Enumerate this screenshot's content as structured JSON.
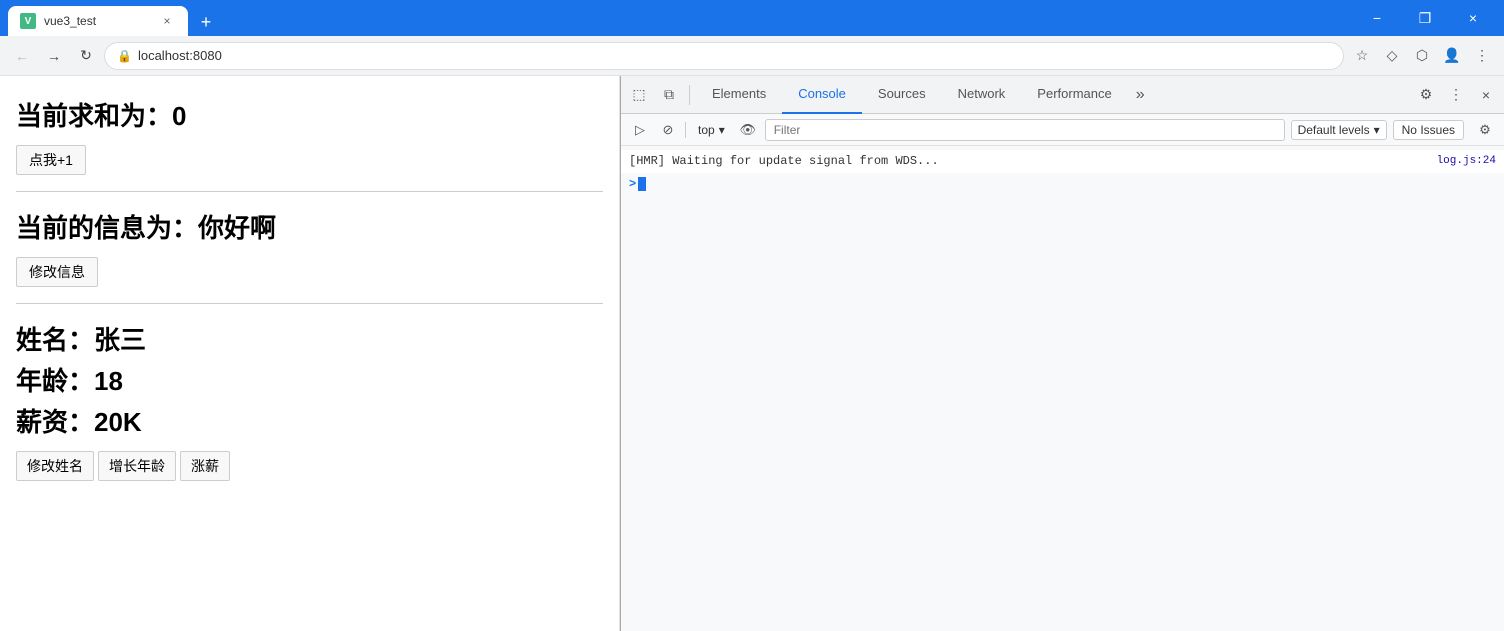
{
  "browser": {
    "tab_favicon": "V",
    "tab_title": "vue3_test",
    "tab_close": "×",
    "new_tab": "+",
    "ctrl_minimize": "−",
    "ctrl_maximize": "❐",
    "ctrl_close": "×",
    "nav_back": "←",
    "nav_forward": "→",
    "nav_refresh": "↻",
    "url_lock": "🔒",
    "url": "localhost:8080",
    "addr_star": "☆",
    "addr_brand1": "◇",
    "addr_brand2": "⬡",
    "addr_profile": "👤",
    "addr_menu": "⋮"
  },
  "devtools": {
    "toolbar": {
      "inspect_icon": "⬚",
      "device_icon": "⧉",
      "tab_elements": "Elements",
      "tab_console": "Console",
      "tab_sources": "Sources",
      "tab_network": "Network",
      "tab_performance": "Performance",
      "tab_more": "»",
      "settings_icon": "⚙",
      "more_icon": "⋮",
      "close_icon": "×"
    },
    "console_toolbar": {
      "play_btn": "▷",
      "ban_btn": "⊘",
      "context_label": "top",
      "context_arrow": "▾",
      "eye_btn": "👁",
      "filter_placeholder": "Filter",
      "levels_label": "Default levels",
      "levels_arrow": "▾",
      "issues_label": "No Issues",
      "settings_icon": "⚙"
    },
    "console": {
      "hmr_message": "[HMR] Waiting for update signal from WDS...",
      "hmr_source": "log.js:24",
      "prompt_symbol": ">"
    }
  },
  "webpage": {
    "sum_title": "当前求和为：0",
    "btn_click": "点我+1",
    "info_title": "当前的信息为：你好啊",
    "btn_edit_info": "修改信息",
    "person_name": "姓名：张三",
    "person_age": "年龄：18",
    "person_salary": "薪资：20K",
    "btn_edit_name": "修改姓名",
    "btn_grow_age": "增长年龄",
    "btn_raise_salary": "涨薪"
  }
}
